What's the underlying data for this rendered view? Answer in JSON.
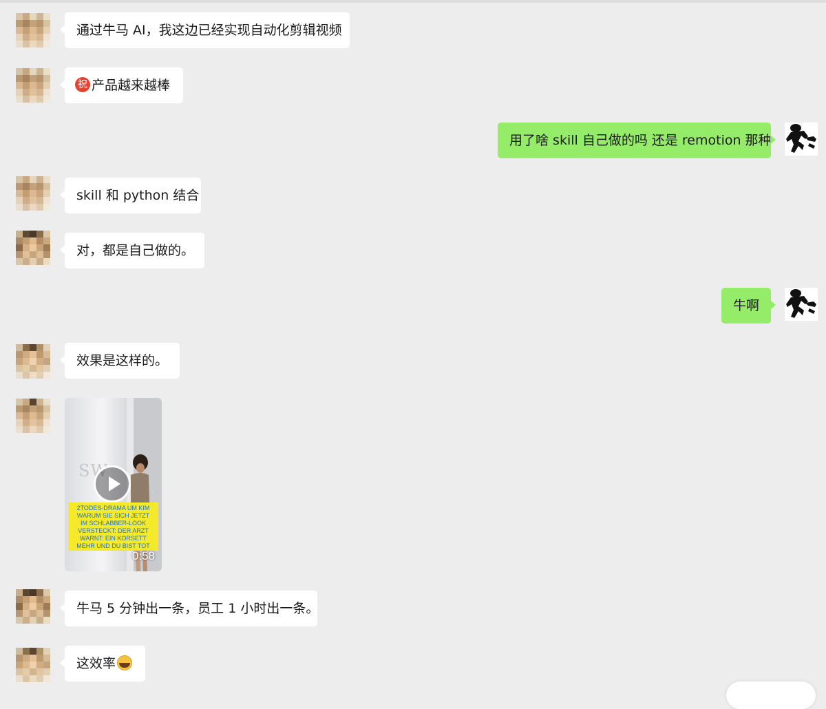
{
  "chat": {
    "messages": [
      {
        "side": "left",
        "text": "通过牛马 AI，我这边已经实现自动化剪辑视频"
      },
      {
        "side": "left",
        "badge": "祝",
        "text": "产品越来越棒"
      },
      {
        "side": "right",
        "text": "用了啥 skill 自己做的吗 还是 remotion 那种"
      },
      {
        "side": "left",
        "text": "skill 和 python 结合"
      },
      {
        "side": "left",
        "text": "对，都是自己做的。"
      },
      {
        "side": "right",
        "text": "牛啊"
      },
      {
        "side": "left",
        "text": "效果是这样的。"
      },
      {
        "side": "left",
        "type": "video",
        "caption": "2TODES-DRAMA UM KIM\nWARUM SIE SICH JETZT\nIM SCHLABBER-LOOK\nVERSTECKT: DER ARZT\nWARNT: EIN KORSETT\nMEHR UND DU BIST TOT",
        "watermark": "SW",
        "duration": "0:58"
      },
      {
        "side": "left",
        "text": "牛马 5 分钟出一条，员工 1 小时出一条。"
      },
      {
        "side": "left",
        "text": "这效率",
        "emoji": "laughing-crying"
      }
    ]
  },
  "colors": {
    "background": "#ededed",
    "bubble_left": "#ffffff",
    "bubble_right": "#95ec69",
    "video_caption_bg": "#f4ea2a",
    "video_caption_text": "#2470c6"
  }
}
